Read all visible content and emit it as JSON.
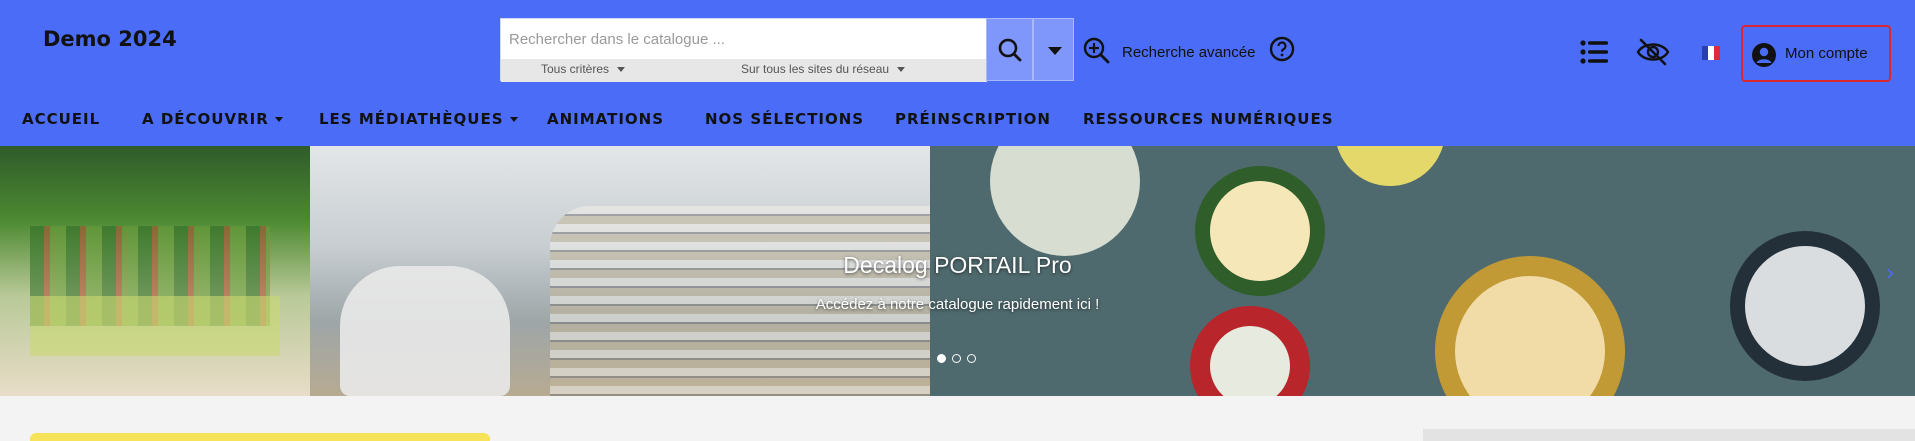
{
  "brand": {
    "title": "Demo 2024"
  },
  "search": {
    "placeholder": "Rechercher dans le catalogue ...",
    "filter_criteria": "Tous critères",
    "filter_sites": "Sur tous les sites du réseau"
  },
  "header": {
    "advanced_search_label": "Recherche avancée",
    "account_label": "Mon compte"
  },
  "nav": {
    "items": [
      {
        "label": "ACCUEIL"
      },
      {
        "label": "A DÉCOUVRIR"
      },
      {
        "label": "LES MÉDIATHÈQUES"
      },
      {
        "label": "ANIMATIONS"
      },
      {
        "label": "NOS SÉLECTIONS"
      },
      {
        "label": "PRÉINSCRIPTION"
      },
      {
        "label": "RESSOURCES NUMÉRIQUES"
      }
    ]
  },
  "hero": {
    "title": "Decalog PORTAIL Pro",
    "subtitle": "Accédez à notre catalogue rapidement ici !",
    "slide_count": 3,
    "active_slide": 1
  },
  "colors": {
    "header_bg": "#4a6cf7",
    "highlight_border": "#d9262f",
    "search_button_bg": "#7f96fb"
  },
  "icons": [
    "search-icon",
    "chevron-down-icon",
    "zoom-in-icon",
    "help-icon",
    "list-icon",
    "eye-off-icon",
    "flag-fr-icon",
    "user-icon",
    "chevron-right-icon"
  ]
}
